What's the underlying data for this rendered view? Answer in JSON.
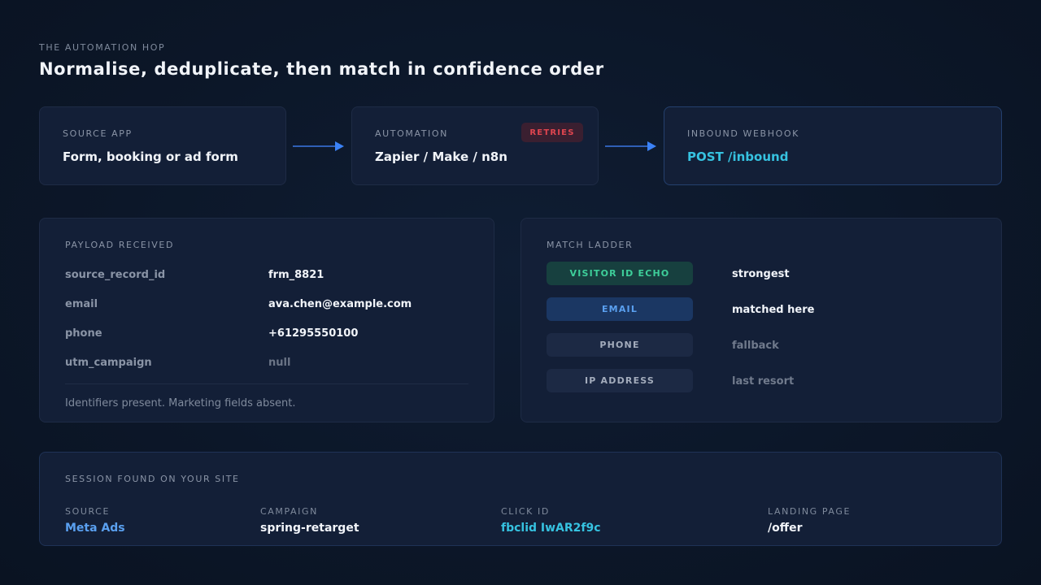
{
  "header": {
    "eyebrow": "THE AUTOMATION HOP",
    "title": "Normalise, deduplicate, then match in confidence order"
  },
  "flow": {
    "source": {
      "label": "SOURCE APP",
      "value": "Form, booking or ad form"
    },
    "automation": {
      "label": "AUTOMATION",
      "value": "Zapier / Make / n8n",
      "badge": "RETRIES"
    },
    "webhook": {
      "label": "INBOUND WEBHOOK",
      "value": "POST /inbound"
    }
  },
  "payload": {
    "label": "PAYLOAD RECEIVED",
    "rows": [
      {
        "key": "source_record_id",
        "value": "frm_8821"
      },
      {
        "key": "email",
        "value": "ava.chen@example.com"
      },
      {
        "key": "phone",
        "value": "+61295550100"
      },
      {
        "key": "utm_campaign",
        "value": "null"
      }
    ],
    "note": "Identifiers present. Marketing fields absent."
  },
  "ladder": {
    "label": "MATCH LADDER",
    "steps": [
      {
        "name": "VISITOR ID ECHO",
        "rank": "strongest"
      },
      {
        "name": "EMAIL",
        "rank": "matched here"
      },
      {
        "name": "PHONE",
        "rank": "fallback"
      },
      {
        "name": "IP ADDRESS",
        "rank": "last resort"
      }
    ]
  },
  "session": {
    "label": "SESSION FOUND ON YOUR SITE",
    "fields": [
      {
        "label": "SOURCE",
        "value": "Meta Ads"
      },
      {
        "label": "CAMPAIGN",
        "value": "spring-retarget"
      },
      {
        "label": "CLICK ID",
        "value": "fbclid IwAR2f9c"
      },
      {
        "label": "LANDING PAGE",
        "value": "/offer"
      }
    ]
  },
  "colors": {
    "accent_blue": "#5aa0f0",
    "accent_cyan": "#36c2e0",
    "accent_teal": "#3ecf9a",
    "retries_red": "#e0454f"
  }
}
